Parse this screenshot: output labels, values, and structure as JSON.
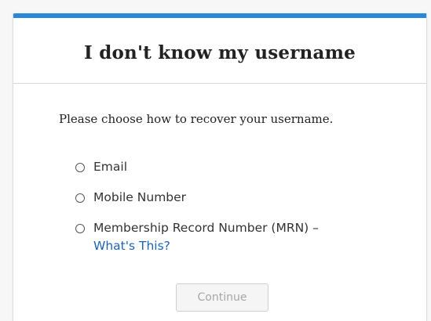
{
  "card": {
    "title": "I don't know my username",
    "prompt": "Please choose how to recover your username.",
    "options": [
      {
        "label": "Email",
        "selected": false
      },
      {
        "label": "Mobile Number",
        "selected": false
      },
      {
        "label": "Membership Record Number (MRN) –",
        "selected": false,
        "link": "What's This?"
      }
    ],
    "continue_label": "Continue",
    "continue_disabled": true
  },
  "colors": {
    "accent_bar": "#2b88d9",
    "link": "#1f63b5",
    "disabled_text": "#a7a7a7"
  }
}
